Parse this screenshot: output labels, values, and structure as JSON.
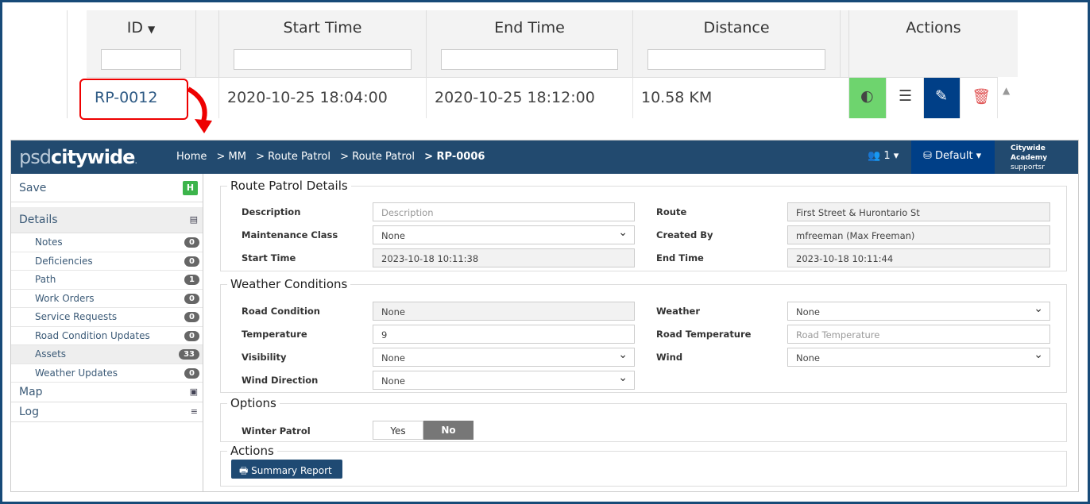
{
  "grid": {
    "headers": [
      "ID",
      "Start Time",
      "End Time",
      "Distance",
      "Actions"
    ],
    "sort_icon": "caret-down-icon",
    "row": {
      "id": "RP-0012",
      "start": "2020-10-25 18:04:00",
      "end": "2020-10-25 18:12:00",
      "distance": "10.58 KM"
    }
  },
  "app": {
    "logo": "psdcitywide",
    "logo_a": "psd",
    "logo_b": "citywide",
    "logo_dot": ".",
    "breadcrumbs": [
      "Home",
      "> MM",
      "> Route Patrol",
      "> Route Patrol",
      "> RP-0006"
    ],
    "users_count": "1",
    "database": "Default",
    "org": "Citywide Academy",
    "user": "supportsr"
  },
  "sidebar": {
    "save": "Save",
    "details": "Details",
    "items": [
      {
        "label": "Notes",
        "count": "0"
      },
      {
        "label": "Deficiencies",
        "count": "0"
      },
      {
        "label": "Path",
        "count": "1"
      },
      {
        "label": "Work Orders",
        "count": "0"
      },
      {
        "label": "Service Requests",
        "count": "0"
      },
      {
        "label": "Road Condition Updates",
        "count": "0"
      },
      {
        "label": "Assets",
        "count": "33"
      },
      {
        "label": "Weather Updates",
        "count": "0"
      }
    ],
    "map": "Map",
    "log": "Log"
  },
  "details": {
    "title": "Route Patrol Details",
    "description_label": "Description",
    "description_placeholder": "Description",
    "route_label": "Route",
    "route": "First Street & Hurontario St",
    "mclass_label": "Maintenance Class",
    "mclass": "None",
    "created_label": "Created By",
    "created": "mfreeman (Max Freeman)",
    "start_label": "Start Time",
    "start": "2023-10-18 10:11:38",
    "end_label": "End Time",
    "end": "2023-10-18 10:11:44"
  },
  "weather": {
    "title": "Weather Conditions",
    "road_cond_label": "Road Condition",
    "road_cond": "None",
    "weather_label": "Weather",
    "weather": "None",
    "temp_label": "Temperature",
    "temp": "9",
    "road_temp_label": "Road Temperature",
    "road_temp_placeholder": "Road Temperature",
    "vis_label": "Visibility",
    "vis": "None",
    "wind_label": "Wind",
    "wind": "None",
    "wdir_label": "Wind Direction",
    "wdir": "None"
  },
  "options": {
    "title": "Options",
    "winter_label": "Winter Patrol",
    "yes": "Yes",
    "no": "No",
    "selected": "No"
  },
  "actions": {
    "title": "Actions",
    "summary": "Summary Report"
  },
  "colors": {
    "nav": "#224a6f",
    "accent": "#003f87",
    "save": "#3cb44b",
    "globe": "#6ed46e"
  }
}
